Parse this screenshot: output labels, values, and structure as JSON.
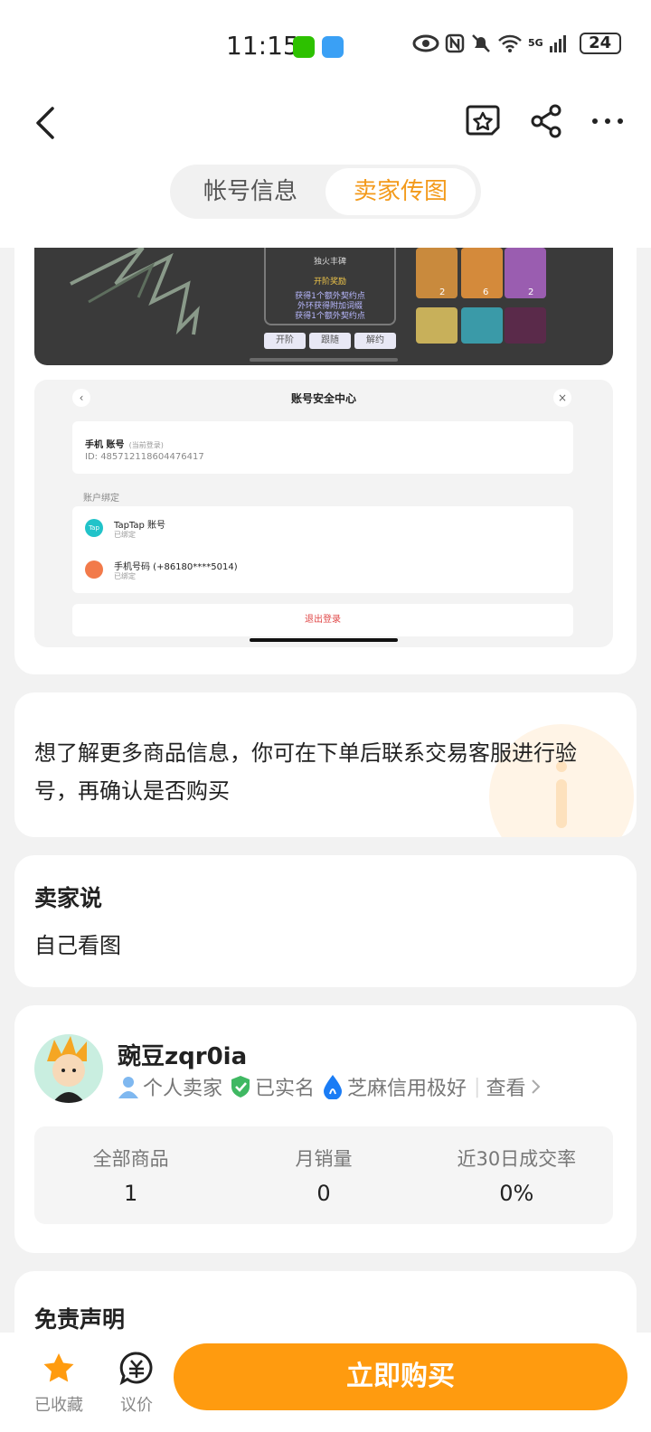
{
  "status_bar": {
    "time": "11:15",
    "network": "5G",
    "battery": "24"
  },
  "header": {
    "tabs": [
      {
        "label": "帐号信息",
        "active": false
      },
      {
        "label": "卖家传图",
        "active": true
      }
    ]
  },
  "game_screenshot": {
    "panel_title": "独火丰碑",
    "panel_subtitle": "开阶奖励",
    "panel_lines": [
      "获得1个额外契约点",
      "外环获得附加词缀",
      "获得1个额外契约点"
    ],
    "buttons": [
      "开阶",
      "跟随",
      "解约"
    ],
    "hero_levels": [
      "2",
      "6",
      "2"
    ]
  },
  "security_screenshot": {
    "title": "账号安全中心",
    "account_label": "手机 账号",
    "account_current": "(当前登录)",
    "account_id": "ID: 485712118604476417",
    "binding_header": "账户绑定",
    "bindings": [
      {
        "name": "TapTap 账号",
        "status": "已绑定",
        "icon": "taptap-icon",
        "icon_text": "Tap"
      },
      {
        "name": "手机号码 (+86180****5014)",
        "status": "已绑定",
        "icon": "phone-icon"
      }
    ],
    "logout": "退出登录"
  },
  "notice": {
    "text": "想了解更多商品信息，你可在下单后联系交易客服进行验号，再确认是否购买"
  },
  "seller_says": {
    "title": "卖家说",
    "content": "自己看图"
  },
  "seller": {
    "name": "豌豆zqr0ia",
    "tags": [
      "个人卖家",
      "已实名",
      "芝麻信用极好"
    ],
    "view_link": "查看",
    "stats": [
      {
        "label": "全部商品",
        "value": "1"
      },
      {
        "label": "月销量",
        "value": "0"
      },
      {
        "label": "近30日成交率",
        "value": "0%"
      }
    ]
  },
  "disclaimer": {
    "title": "免责声明"
  },
  "bottom_bar": {
    "favorite_label": "已收藏",
    "bargain_label": "议价",
    "buy_label": "立即购买"
  },
  "colors": {
    "accent": "#ff9b0f",
    "tab_active": "#f39a1b",
    "verified_green": "#3fb862",
    "sesame_blue": "#1a7cf5",
    "logout_red": "#e04848"
  }
}
